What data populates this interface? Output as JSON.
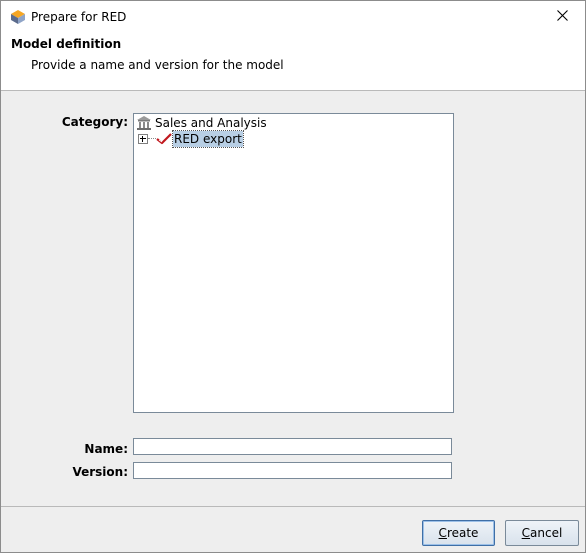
{
  "window": {
    "title": "Prepare for RED"
  },
  "header": {
    "title": "Model definition",
    "subtitle": "Provide a name and version for the model"
  },
  "form": {
    "category_label": "Category:",
    "name_label": "Name:",
    "version_label": "Version:",
    "name_value": "",
    "version_value": ""
  },
  "tree": {
    "root_label": "Sales and Analysis",
    "child_label": "RED export"
  },
  "buttons": {
    "create_mnemonic": "C",
    "create_rest": "reate",
    "cancel_mnemonic": "C",
    "cancel_rest": "ancel"
  },
  "colors": {
    "selection": "#b8cfe5",
    "background": "#eeeeee",
    "accent_red": "#c0181e"
  },
  "icons": {
    "app": "app-logo-icon",
    "close": "close-icon",
    "root": "building-icon",
    "child": "red-check-icon",
    "expander": "expand-plus-icon"
  }
}
